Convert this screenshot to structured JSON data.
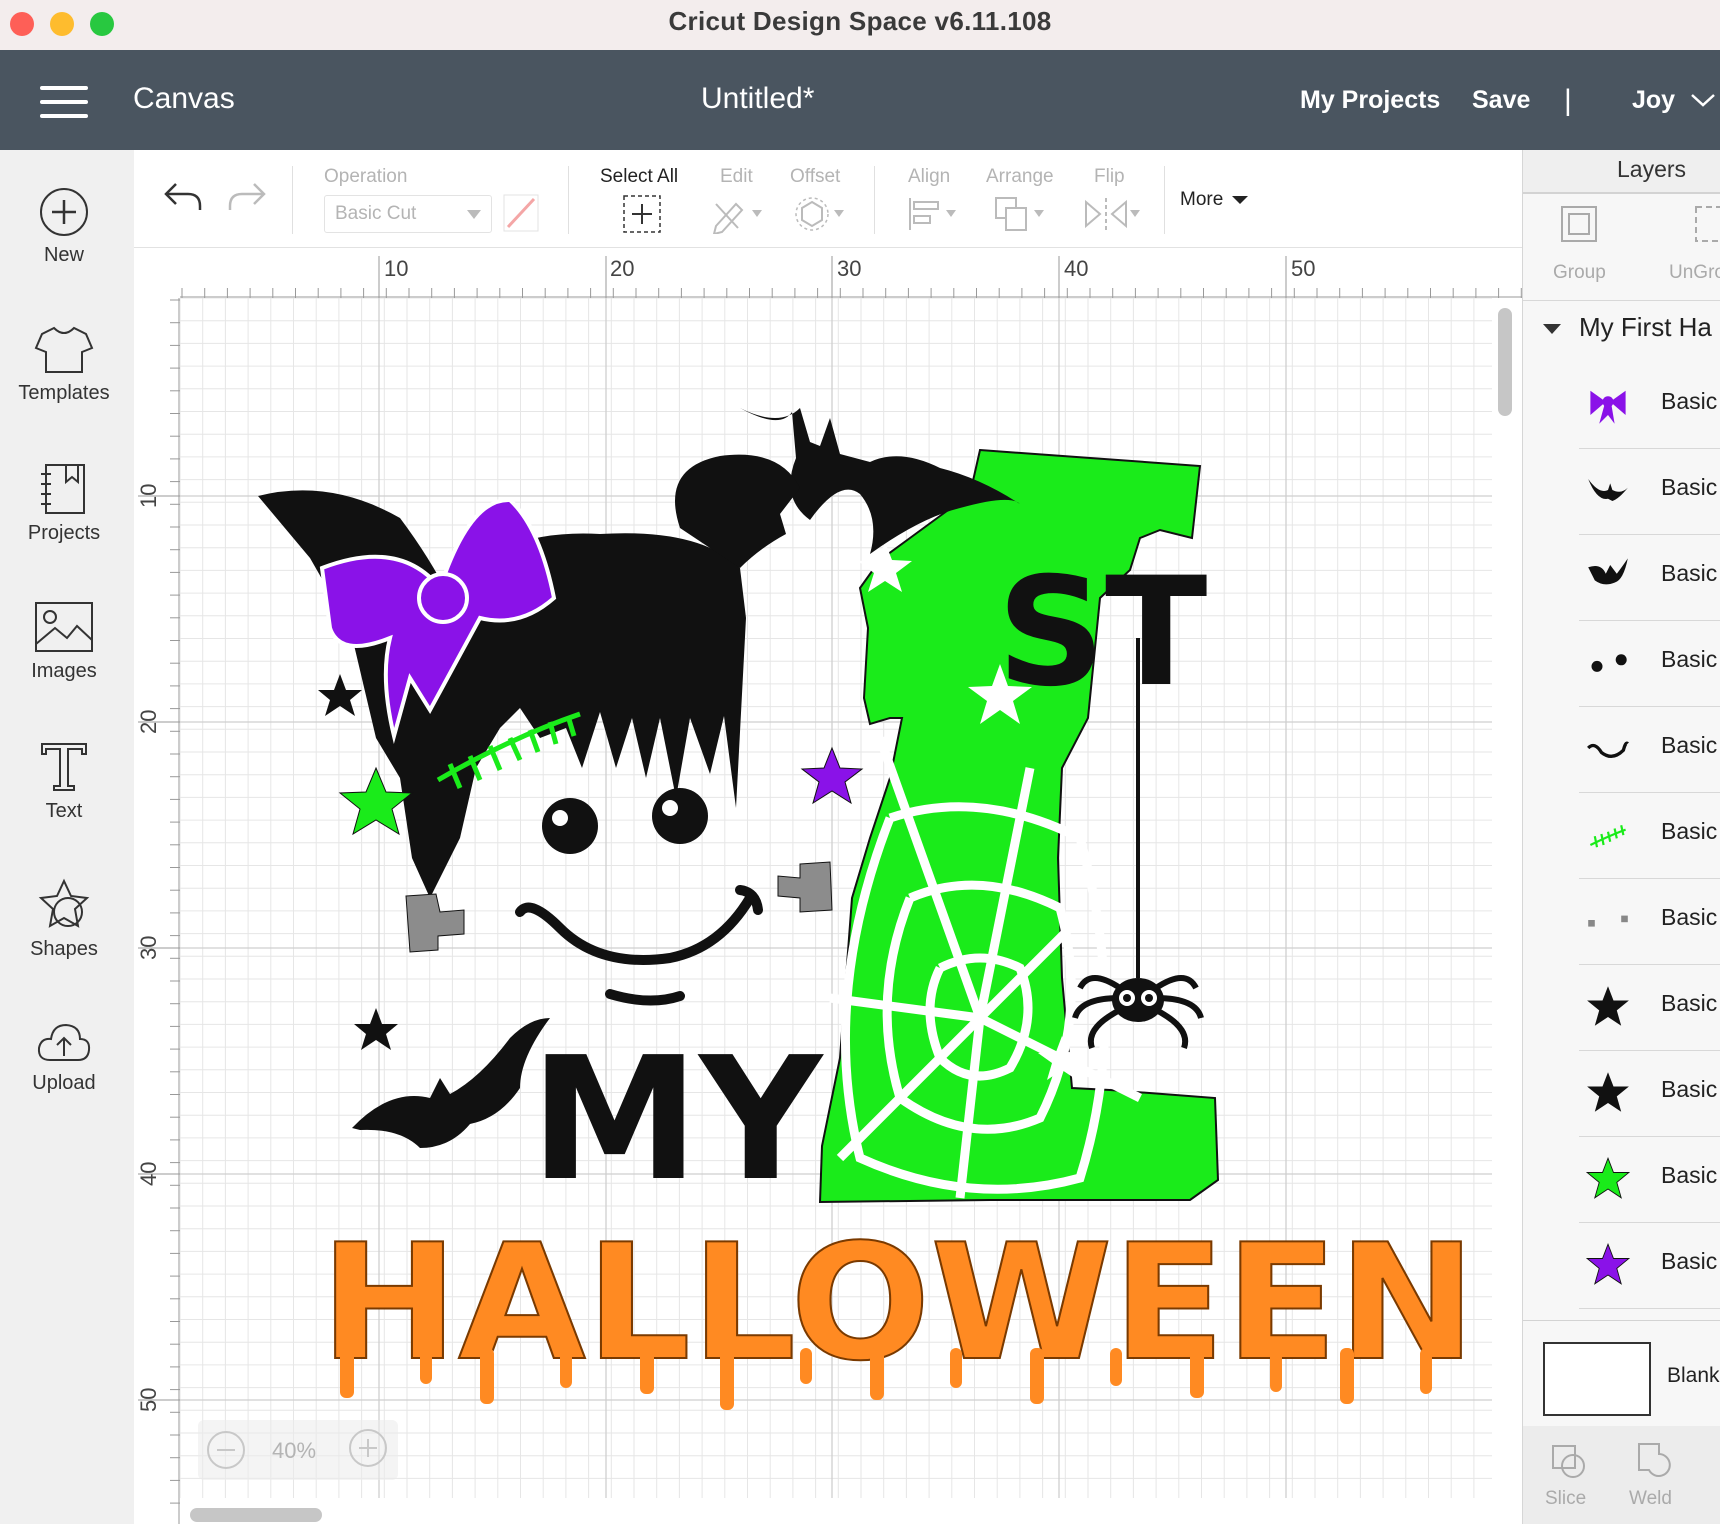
{
  "window": {
    "title": "Cricut Design Space  v6.11.108"
  },
  "header": {
    "section": "Canvas",
    "doc_title": "Untitled*",
    "my_projects": "My Projects",
    "save": "Save",
    "divider": "|",
    "user": "Joy"
  },
  "sidebar": {
    "items": [
      {
        "label": "New",
        "icon": "plus-circle-icon"
      },
      {
        "label": "Templates",
        "icon": "tshirt-icon"
      },
      {
        "label": "Projects",
        "icon": "notebook-icon"
      },
      {
        "label": "Images",
        "icon": "image-icon"
      },
      {
        "label": "Text",
        "icon": "text-t-icon"
      },
      {
        "label": "Shapes",
        "icon": "shapes-icon"
      },
      {
        "label": "Upload",
        "icon": "cloud-upload-icon"
      }
    ]
  },
  "toolbar": {
    "operation_label": "Operation",
    "operation_value": "Basic Cut",
    "select_all": "Select All",
    "edit": "Edit",
    "offset": "Offset",
    "align": "Align",
    "arrange": "Arrange",
    "flip": "Flip",
    "more": "More"
  },
  "rulers": {
    "top": [
      "10",
      "20",
      "30",
      "40",
      "50"
    ],
    "left": [
      "10",
      "20",
      "30",
      "40",
      "50"
    ]
  },
  "zoom": {
    "level": "40%"
  },
  "design": {
    "word1": "MY",
    "word2": "HALLOWEEN",
    "numeral": "1",
    "suffix": "ST",
    "colors": {
      "green": "#1aeb1a",
      "orange": "#ff8a22",
      "purple": "#8a12e8",
      "black": "#111111",
      "gray": "#8c8c8c"
    }
  },
  "layers": {
    "title": "Layers",
    "group": "Group",
    "ungroup": "UnGro",
    "group_name": "My First Ha",
    "rows": [
      {
        "label": "Basic",
        "thumb": "purple-bow-icon"
      },
      {
        "label": "Basic",
        "thumb": "bat-icon"
      },
      {
        "label": "Basic",
        "thumb": "bats-hair-icon"
      },
      {
        "label": "Basic",
        "thumb": "eyes-icon"
      },
      {
        "label": "Basic",
        "thumb": "smile-icon"
      },
      {
        "label": "Basic",
        "thumb": "stitches-icon"
      },
      {
        "label": "Basic",
        "thumb": "bolts-icon"
      },
      {
        "label": "Basic",
        "thumb": "black-star-icon"
      },
      {
        "label": "Basic",
        "thumb": "black-star-icon"
      },
      {
        "label": "Basic",
        "thumb": "green-star-icon"
      },
      {
        "label": "Basic",
        "thumb": "purple-star-icon"
      }
    ],
    "blank": "Blank",
    "slice": "Slice",
    "weld": "Weld"
  }
}
